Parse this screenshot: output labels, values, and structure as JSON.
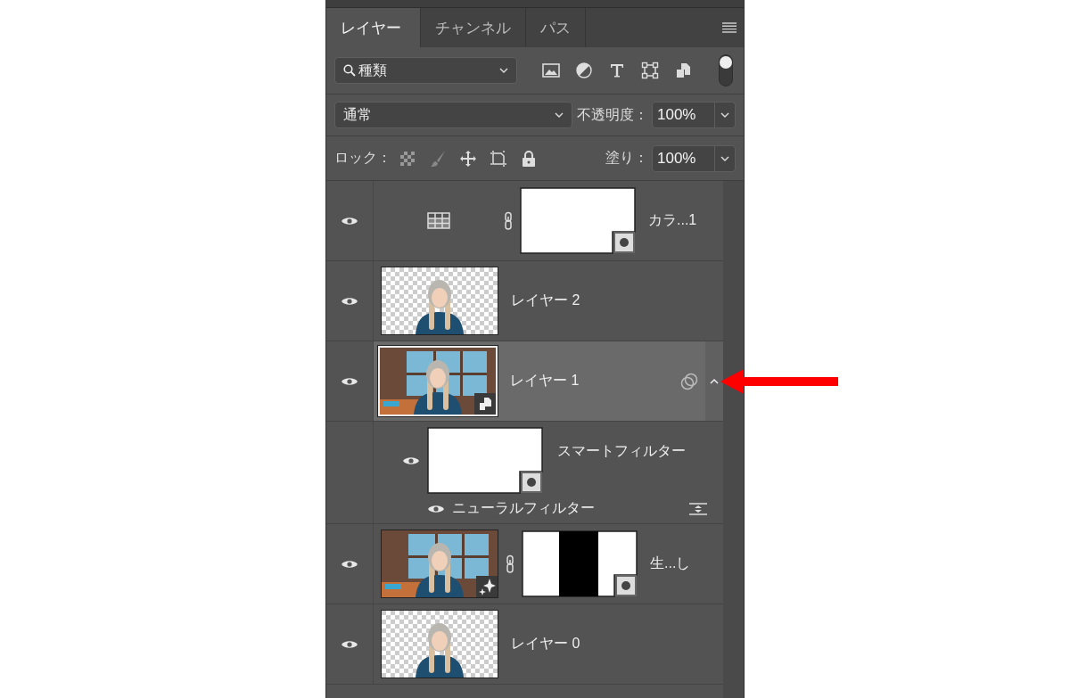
{
  "tabs": [
    {
      "label": "レイヤー",
      "selected": true
    },
    {
      "label": "チャンネル",
      "selected": false
    },
    {
      "label": "パス",
      "selected": false
    }
  ],
  "filter": {
    "value": "種類",
    "toggle_on": true
  },
  "blend_mode": {
    "value": "通常"
  },
  "opacity": {
    "label": "不透明度：",
    "value": "100%"
  },
  "lock": {
    "label": "ロック："
  },
  "fill": {
    "label": "塗り：",
    "value": "100%"
  },
  "layers": [
    {
      "name": "カラ...1",
      "visible": true,
      "selected": false,
      "kind": "adjustment",
      "linked": true,
      "mask": {
        "kind": "plain"
      }
    },
    {
      "name": "レイヤー 2",
      "visible": true,
      "selected": false,
      "kind": "pixel",
      "transparent": true
    },
    {
      "name": "レイヤー 1",
      "visible": true,
      "selected": true,
      "kind": "smart",
      "transparent": false,
      "expanded": true,
      "smart_filters": {
        "label": "スマートフィルター",
        "visible": true,
        "filters": [
          {
            "name": "ニューラルフィルター",
            "visible": true
          }
        ]
      }
    },
    {
      "name": "生...し",
      "visible": true,
      "selected": false,
      "kind": "generative",
      "transparent": false,
      "linked": true,
      "mask": {
        "kind": "stripe"
      }
    },
    {
      "name": "レイヤー 0",
      "visible": true,
      "selected": false,
      "kind": "pixel",
      "transparent": true
    }
  ]
}
